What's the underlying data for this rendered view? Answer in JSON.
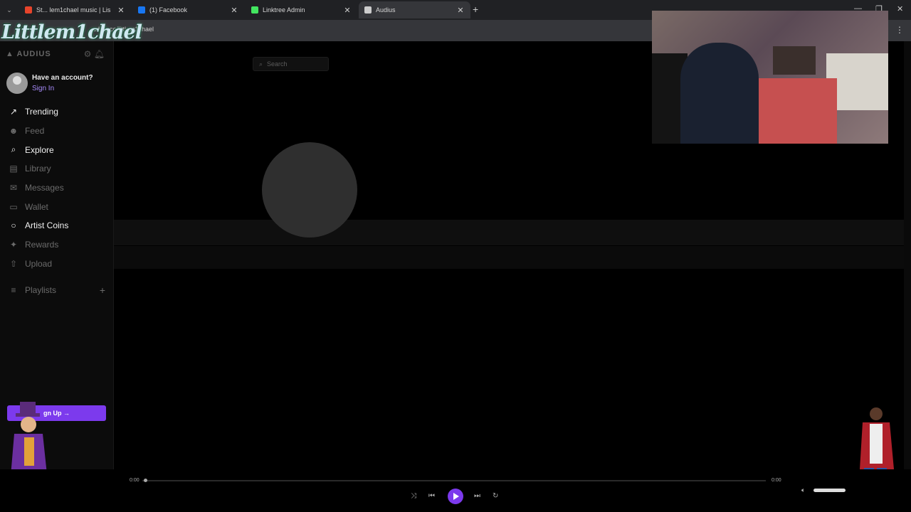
{
  "browser": {
    "tabs": [
      {
        "title": "St... lem1chael music | Lis",
        "favicon_color": "#e7442b"
      },
      {
        "title": "(1) Facebook",
        "favicon_color": "#1877f2"
      },
      {
        "title": "Linktree Admin",
        "favicon_color": "#43e660"
      },
      {
        "title": "Audius",
        "favicon_color": "#cccccc",
        "active": true
      }
    ],
    "url": "udius.co/littlem1chael",
    "new_tab": "+",
    "close": "✕"
  },
  "app": {
    "brand": "AUDIUS",
    "account": {
      "question": "Have an account?",
      "sign_in": "Sign In"
    },
    "nav": [
      {
        "label": "Trending",
        "icon": "trending-icon",
        "glyph": "↗",
        "bright": true
      },
      {
        "label": "Feed",
        "icon": "feed-icon",
        "glyph": "☻",
        "bright": false
      },
      {
        "label": "Explore",
        "icon": "search-icon",
        "glyph": "⌕",
        "bright": true
      },
      {
        "label": "Library",
        "icon": "library-icon",
        "glyph": "▤",
        "bright": false
      },
      {
        "label": "Messages",
        "icon": "messages-icon",
        "glyph": "✉",
        "bright": false
      },
      {
        "label": "Wallet",
        "icon": "wallet-icon",
        "glyph": "▭",
        "bright": false
      },
      {
        "label": "Artist Coins",
        "icon": "coin-icon",
        "glyph": "○",
        "bright": true
      },
      {
        "label": "Rewards",
        "icon": "gift-icon",
        "glyph": "✦",
        "bright": false
      },
      {
        "label": "Upload",
        "icon": "upload-icon",
        "glyph": "⇧",
        "bright": false
      }
    ],
    "playlists": {
      "label": "Playlists",
      "add": "+"
    },
    "signup": "gn Up →",
    "search": {
      "placeholder": "Search"
    }
  },
  "overlay": {
    "logo": "Littlem1chael"
  },
  "player": {
    "time_elapsed": "0:00",
    "time_total": "0:00",
    "progress": 0,
    "accent": "#7c3aed"
  }
}
